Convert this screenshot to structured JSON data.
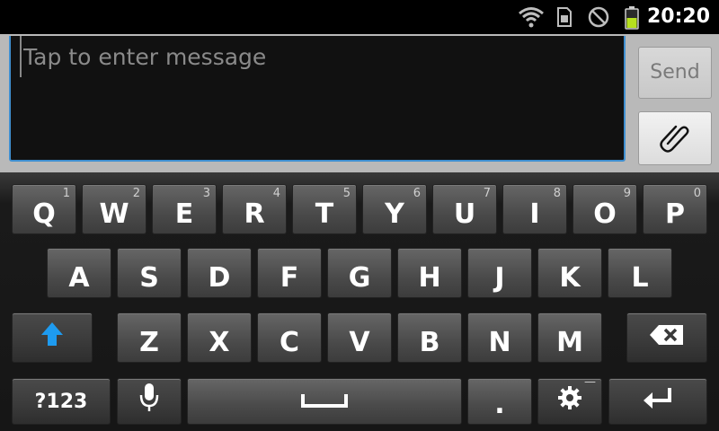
{
  "status_bar": {
    "time": "20:20",
    "icons": [
      "wifi-icon",
      "sim-card-icon",
      "do-not-disturb-icon",
      "battery-icon"
    ],
    "battery_color": "#b6e01e"
  },
  "compose": {
    "placeholder": "Tap to enter message",
    "value": "",
    "send_label": "Send",
    "attach_icon": "paperclip-icon"
  },
  "keyboard": {
    "row1": [
      {
        "letter": "Q",
        "hint": "1"
      },
      {
        "letter": "W",
        "hint": "2"
      },
      {
        "letter": "E",
        "hint": "3"
      },
      {
        "letter": "R",
        "hint": "4"
      },
      {
        "letter": "T",
        "hint": "5"
      },
      {
        "letter": "Y",
        "hint": "6"
      },
      {
        "letter": "U",
        "hint": "7"
      },
      {
        "letter": "I",
        "hint": "8"
      },
      {
        "letter": "O",
        "hint": "9"
      },
      {
        "letter": "P",
        "hint": "0"
      }
    ],
    "row2": [
      "A",
      "S",
      "D",
      "F",
      "G",
      "H",
      "J",
      "K",
      "L"
    ],
    "row3": [
      "Z",
      "X",
      "C",
      "V",
      "B",
      "N",
      "M"
    ],
    "symbols_label": "?123",
    "period_label": ".",
    "hint_dash": "—",
    "accent_color": "#1e9bf0"
  }
}
